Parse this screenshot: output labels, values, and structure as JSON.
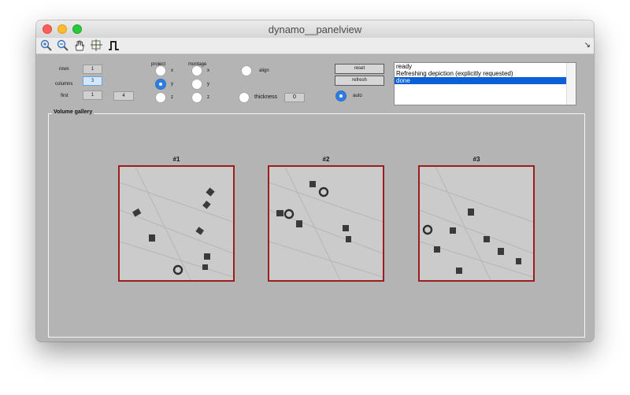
{
  "window": {
    "title": "dynamo__panelview"
  },
  "toolbar": {
    "icons": [
      "zoom-in-icon",
      "zoom-out-icon",
      "pan-hand-icon",
      "data-cursor-icon",
      "pulse-icon"
    ],
    "corner_glyph": "↘"
  },
  "controls": {
    "rows_label": "rows",
    "rows_value": "1",
    "columns_label": "columns",
    "columns_value": "3",
    "first_label": "first",
    "first_value": "1",
    "count_value": "4",
    "project_label": "project",
    "montage_label": "montage",
    "project_options": [
      "x",
      "y",
      "z"
    ],
    "project_selected": "y",
    "montage_options": [
      "x",
      "y",
      "z"
    ],
    "align_label": "align",
    "thickness_label": "thickness",
    "thickness_value": "0",
    "reset_label": "reset",
    "refresh_label": "refresh",
    "auto_label": "auto",
    "auto_on": true
  },
  "log": {
    "lines": [
      "ready",
      "Refreshing depiction (explicitly requested)",
      "done"
    ],
    "selected_index": 2
  },
  "gallery": {
    "title": "Volume gallery",
    "panels": [
      {
        "label": "#1"
      },
      {
        "label": "#2"
      },
      {
        "label": "#3"
      }
    ]
  },
  "colors": {
    "panel_border": "#9c1d1d",
    "selection": "#0b5fd7",
    "radio_on": "#2f7de1",
    "background": "#b4b4b4"
  }
}
